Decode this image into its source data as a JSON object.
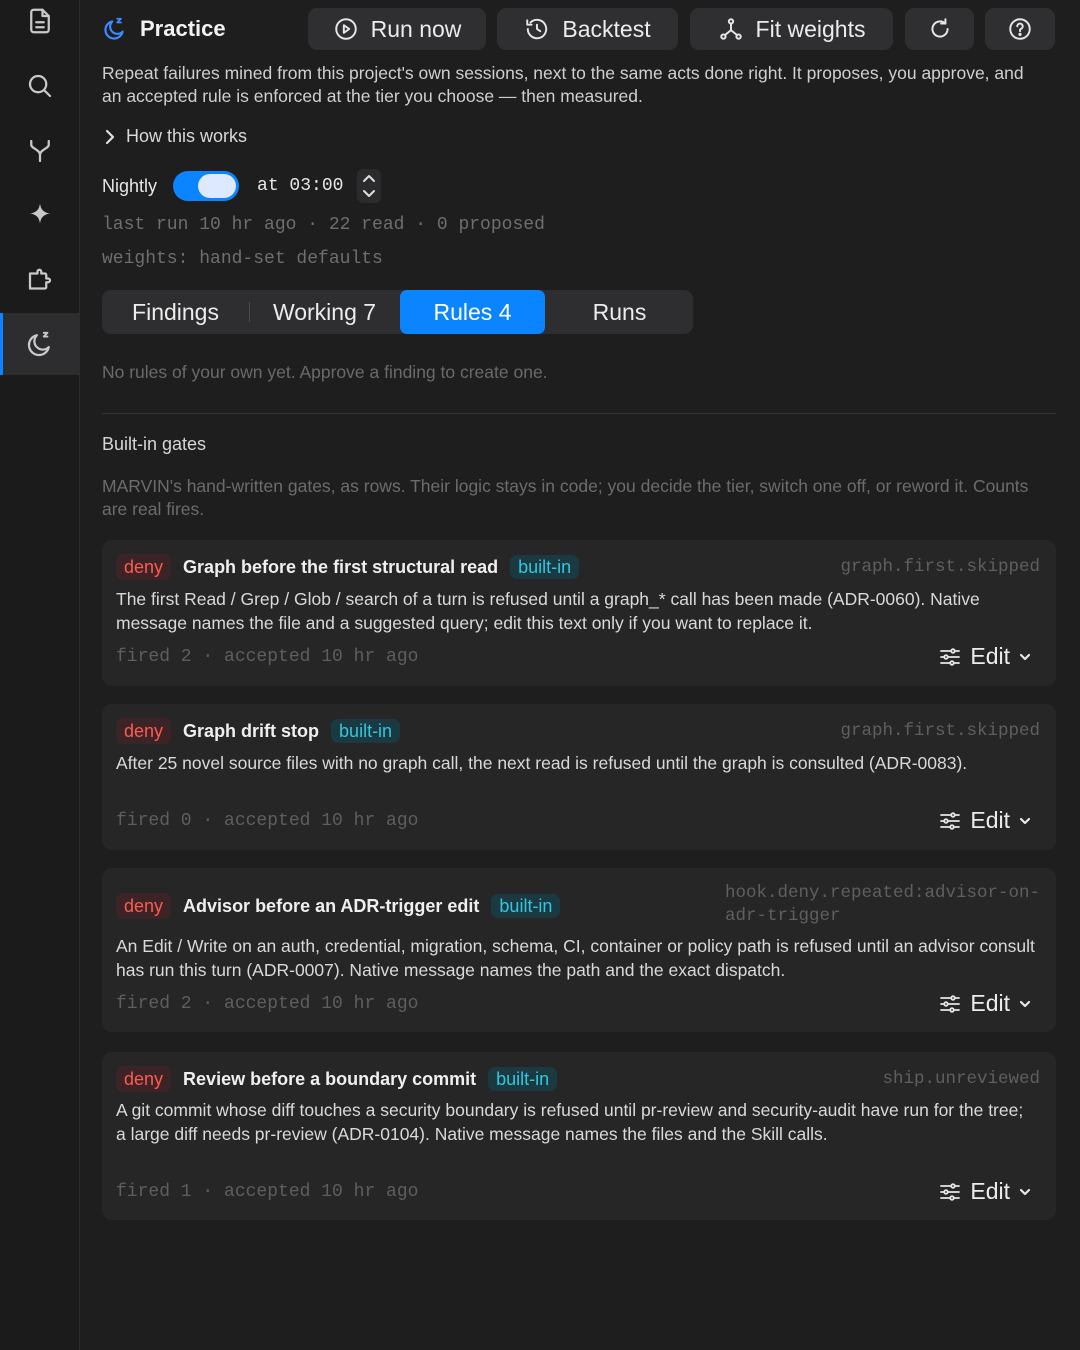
{
  "header": {
    "title": "Practice",
    "buttons": {
      "run_now": "Run now",
      "backtest": "Backtest",
      "fit_weights": "Fit weights"
    }
  },
  "intro": "Repeat failures mined from this project's own sessions, next to the same acts done right. It proposes, you approve, and an accepted rule is enforced at the tier you choose — then measured.",
  "how_link": "How this works",
  "schedule": {
    "label": "Nightly",
    "enabled": true,
    "at_text": "at 03:00"
  },
  "status": {
    "last_run": "last run 10 hr ago · 22 read · 0 proposed",
    "weights": "weights: hand-set defaults"
  },
  "tabs": [
    {
      "label": "Findings",
      "active": false
    },
    {
      "label": "Working 7",
      "active": false
    },
    {
      "label": "Rules 4",
      "active": true
    },
    {
      "label": "Runs",
      "active": false
    }
  ],
  "empty_message": "No rules of your own yet. Approve a finding to create one.",
  "builtin": {
    "title": "Built-in gates",
    "description": "MARVIN's hand-written gates, as rows. Their logic stays in code; you decide the tier, switch one off, or reword it. Counts are real fires."
  },
  "rules": [
    {
      "tier": "deny",
      "title": "Graph before the first structural read",
      "badge": "built-in",
      "key": "graph.first.skipped",
      "description": "The first Read / Grep / Glob / search of a turn is refused until a graph_* call has been made (ADR-0060). Native message names the file and a suggested query; edit this text only if you want to replace it.",
      "stats": "fired 2 · accepted 10 hr ago",
      "edit_label": "Edit"
    },
    {
      "tier": "deny",
      "title": "Graph drift stop",
      "badge": "built-in",
      "key": "graph.first.skipped",
      "description": "After 25 novel source files with no graph call, the next read is refused until the graph is consulted (ADR-0083).",
      "stats": "fired 0 · accepted 10 hr ago",
      "edit_label": "Edit"
    },
    {
      "tier": "deny",
      "title": "Advisor before an ADR-trigger edit",
      "badge": "built-in",
      "key_line1": "hook.deny.repeated:advisor-on-",
      "key_line2": "adr-trigger",
      "description": "An Edit / Write on an auth, credential, migration, schema, CI, container or policy path is refused until an advisor consult has run this turn (ADR-0007). Native message names the path and the exact dispatch.",
      "stats": "fired 2 · accepted 10 hr ago",
      "edit_label": "Edit"
    },
    {
      "tier": "deny",
      "title": "Review before a boundary commit",
      "badge": "built-in",
      "key": "ship.unreviewed",
      "description": "A git commit whose diff touches a security boundary is refused until pr-review and security-audit have run for the tree; a large diff needs pr-review (ADR-0104). Native message names the files and the Skill calls.",
      "stats": "fired 1 · accepted 10 hr ago",
      "edit_label": "Edit"
    }
  ],
  "icons": {
    "rail": [
      "document-icon",
      "search-icon",
      "branch-icon",
      "sparkle-icon",
      "plugin-icon",
      "practice-moon-icon"
    ],
    "active_rail": "practice-moon-icon"
  },
  "colors": {
    "accent": "#0a84ff",
    "deny": "#ff5a4f",
    "builtin": "#33c6df"
  }
}
